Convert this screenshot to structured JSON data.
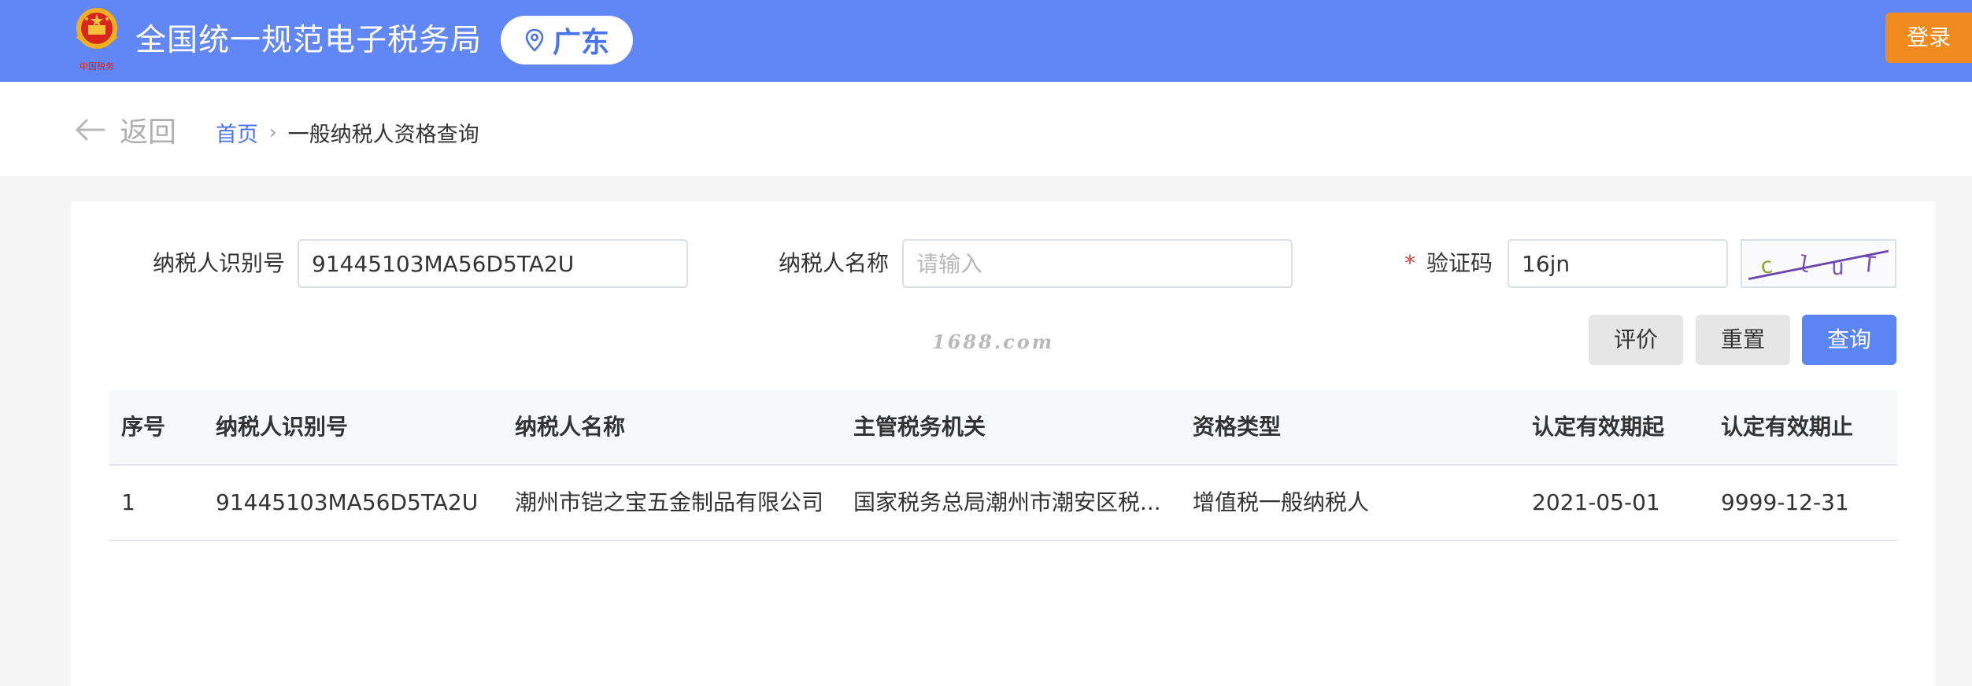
{
  "header": {
    "site_title": "全国统一规范电子税务局",
    "region": "广东",
    "login_label": "登录",
    "brand_color": "#6186f5",
    "login_color": "#f08a1d"
  },
  "breadcrumb": {
    "back_label": "返回",
    "home_label": "首页",
    "separator": "›",
    "current_label": "一般纳税人资格查询"
  },
  "form": {
    "taxpayer_id_label": "纳税人识别号",
    "taxpayer_id_value": "91445103MA56D5TA2U",
    "taxpayer_name_label": "纳税人名称",
    "taxpayer_name_placeholder": "请输入",
    "taxpayer_name_value": "",
    "captcha_required_mark": "*",
    "captcha_label": "验证码",
    "captcha_value": "16jn",
    "captcha_chars": [
      "c",
      "l",
      "u",
      "T"
    ]
  },
  "buttons": {
    "evaluate_label": "评价",
    "reset_label": "重置",
    "query_label": "查询",
    "primary_color": "#5b84f6"
  },
  "watermark": "1688.com",
  "table": {
    "columns": [
      "序号",
      "纳税人识别号",
      "纳税人名称",
      "主管税务机关",
      "资格类型",
      "认定有效期起",
      "认定有效期止"
    ],
    "rows": [
      {
        "index": "1",
        "taxpayer_id": "91445103MA56D5TA2U",
        "taxpayer_name": "潮州市铠之宝五金制品有限公司",
        "tax_authority": "国家税务总局潮州市潮安区税...",
        "qualification_type": "增值税一般纳税人",
        "valid_from": "2021-05-01",
        "valid_to": "9999-12-31"
      }
    ]
  }
}
